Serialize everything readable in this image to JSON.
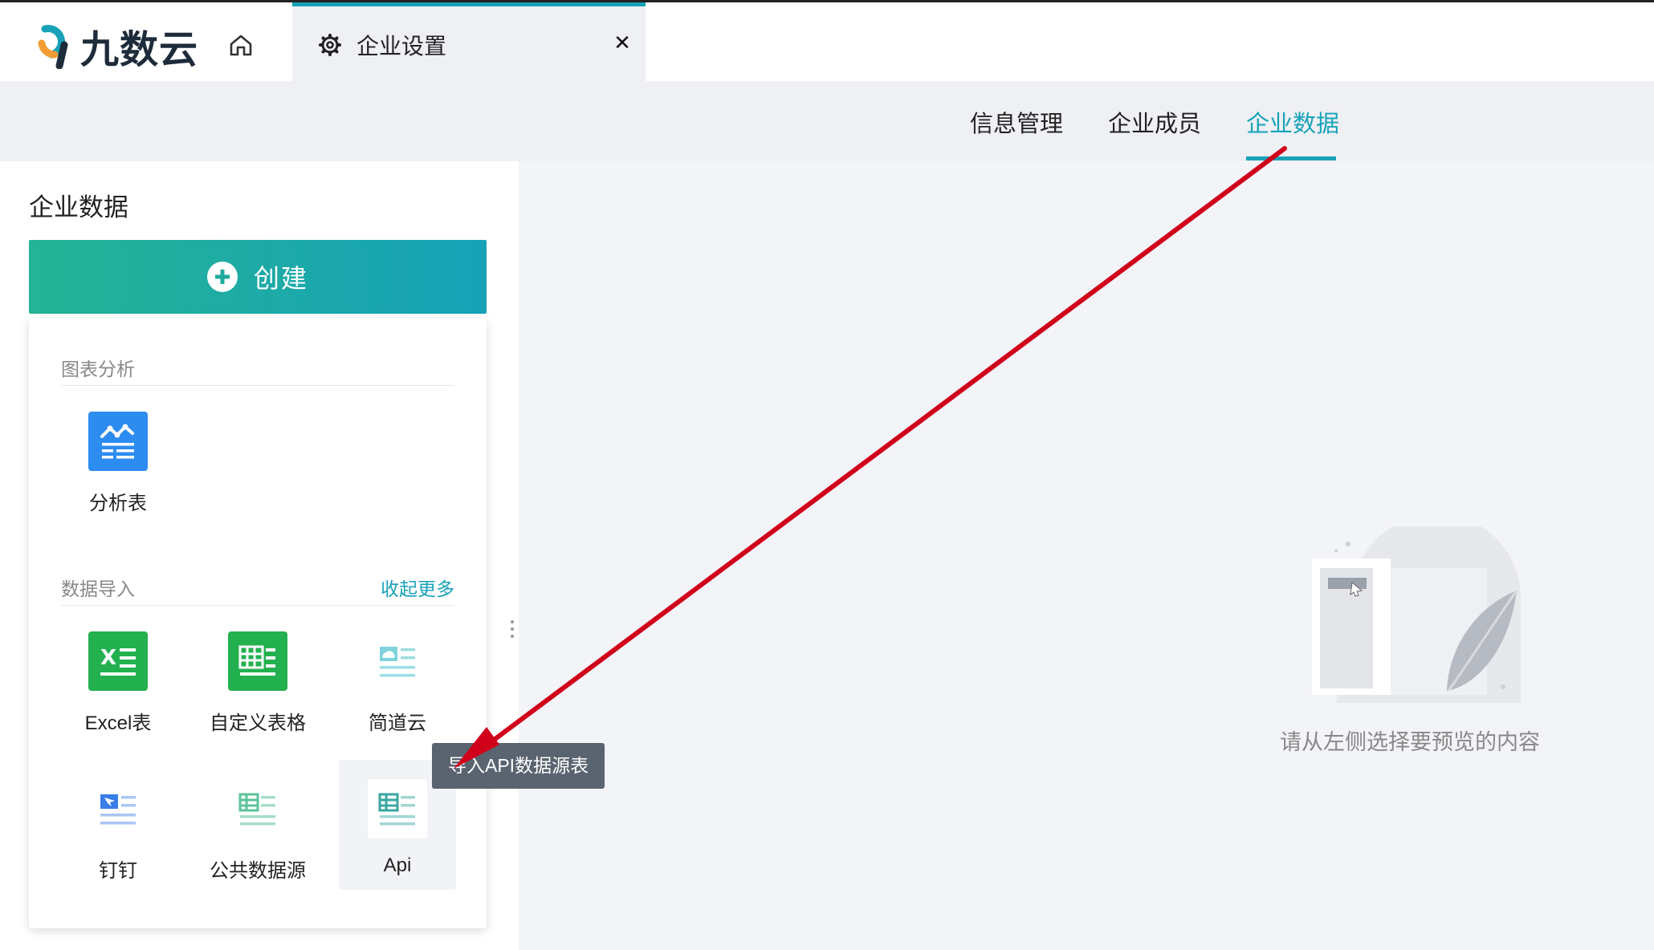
{
  "app": {
    "logo_text": "九数云"
  },
  "tabs": [
    {
      "label": "企业设置"
    }
  ],
  "subnav": {
    "items": [
      {
        "label": "信息管理"
      },
      {
        "label": "企业成员"
      },
      {
        "label": "企业数据"
      }
    ],
    "active_index": 2
  },
  "left_panel": {
    "title": "企业数据",
    "create_label": "创建"
  },
  "dropdown": {
    "section_charts": {
      "title": "图表分析",
      "items": [
        {
          "label": "分析表",
          "icon": "chart-analysis-icon"
        }
      ]
    },
    "section_import": {
      "title": "数据导入",
      "toggle_label": "收起更多",
      "items": [
        {
          "label": "Excel表",
          "icon": "excel-icon"
        },
        {
          "label": "自定义表格",
          "icon": "custom-table-icon"
        },
        {
          "label": "简道云",
          "icon": "jiandaoyun-icon"
        },
        {
          "label": "钉钉",
          "icon": "dingtalk-icon"
        },
        {
          "label": "公共数据源",
          "icon": "public-datasource-icon"
        },
        {
          "label": "Api",
          "icon": "api-icon"
        }
      ]
    }
  },
  "tooltip": {
    "text": "导入API数据源表"
  },
  "empty_state": {
    "text": "请从左侧选择要预览的内容"
  },
  "colors": {
    "accent": "#17a2b8",
    "create_gradient_start": "#24b394",
    "excel_green": "#23b04f",
    "chart_blue": "#2d8cf0",
    "annotation_red": "#d0021b"
  }
}
